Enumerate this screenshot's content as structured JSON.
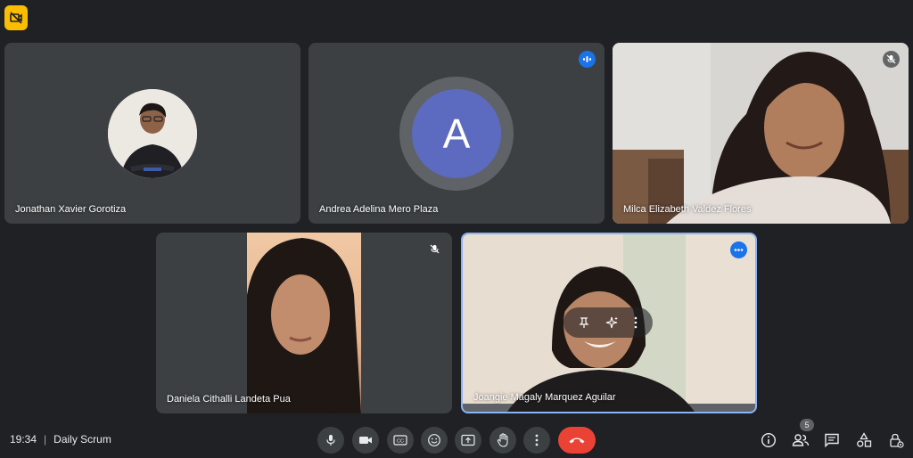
{
  "colors": {
    "background": "#202124",
    "tile": "#3c4043",
    "active_border": "#8ab4f8",
    "accent_blue": "#1a73e8",
    "end_call": "#ea4335",
    "badge_yellow": "#fbbc04"
  },
  "top": {
    "badge_icon": "no-camera-icon"
  },
  "participants": [
    {
      "name": "Jonathan Xavier Gorotiza",
      "display": "avatar-photo"
    },
    {
      "name": "Andrea Adelina Mero Plaza",
      "display": "avatar-letter",
      "initial": "A",
      "speaking": true
    },
    {
      "name": "Milca Elizabeth Valdez Flores",
      "display": "video",
      "muted": true
    },
    {
      "name": "Daniela Cithalli Landeta Pua",
      "display": "video",
      "muted": true
    },
    {
      "name": "Joangie Magaly Marquez Aguilar",
      "display": "video",
      "active": true
    }
  ],
  "meeting": {
    "time": "19:34",
    "separator": "|",
    "title": "Daily Scrum"
  },
  "controls": {
    "center": [
      "mic-icon",
      "camera-icon",
      "captions-icon",
      "emoji-icon",
      "present-icon",
      "raise-hand-icon",
      "more-options-icon",
      "end-call-icon"
    ],
    "right": [
      "info-icon",
      "people-icon",
      "chat-icon",
      "activities-icon",
      "host-controls-icon"
    ]
  },
  "people_count": "5"
}
